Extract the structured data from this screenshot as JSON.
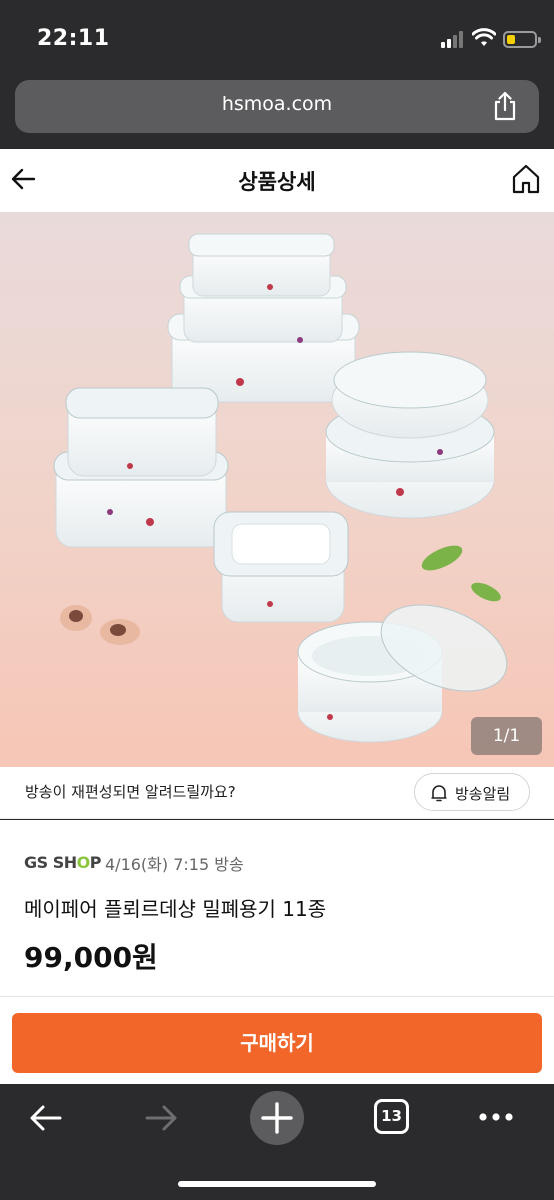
{
  "status_bar": {
    "time": "22:11"
  },
  "browser": {
    "url": "hsmoa.com",
    "tab_count": "13"
  },
  "header": {
    "title": "상품상세"
  },
  "image": {
    "pager": "1/1"
  },
  "notify": {
    "question": "방송이 재편성되면 알려드릴까요?",
    "button_label": "방송알림"
  },
  "product": {
    "brand_prefix": "GS SH",
    "brand_o": "O",
    "brand_suffix": "P",
    "broadcast_time": "4/16(화) 7:15 방송",
    "name": "메이페어 플뢰르데샹 밀폐용기 11종",
    "price": "99,000원"
  },
  "actions": {
    "buy_label": "구매하기"
  },
  "colors": {
    "accent": "#f2662a",
    "brand_green": "#8cc63f"
  }
}
